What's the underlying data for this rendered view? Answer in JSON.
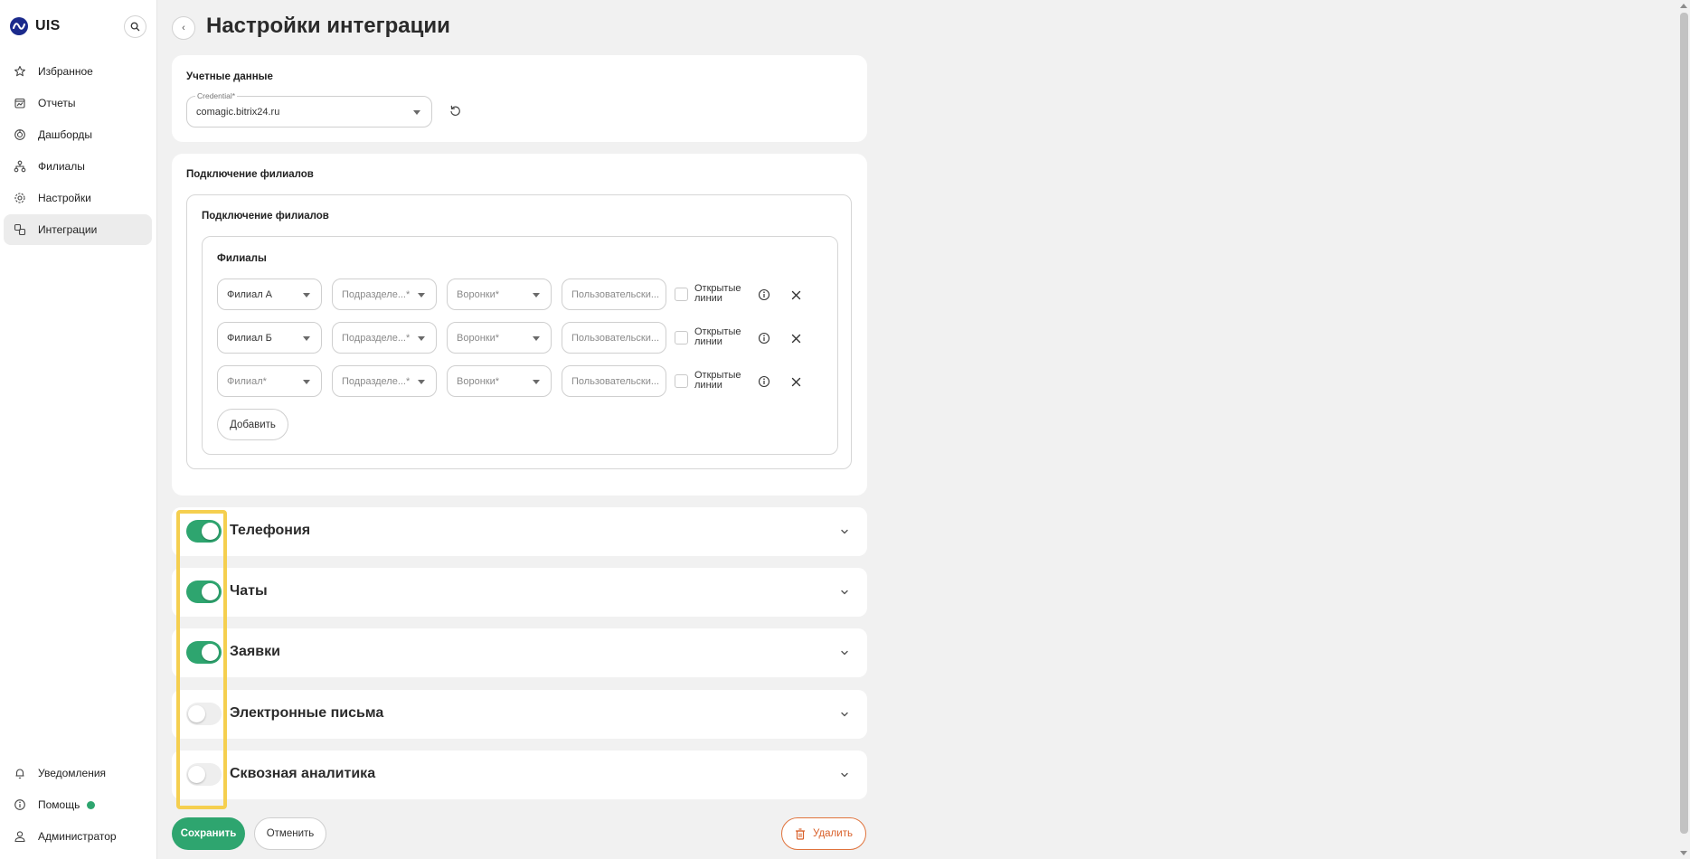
{
  "app": {
    "logo_text": "UIS"
  },
  "sidebar": {
    "items": [
      {
        "label": "Избранное",
        "icon": "star-icon"
      },
      {
        "label": "Отчеты",
        "icon": "reports-icon"
      },
      {
        "label": "Дашборды",
        "icon": "dashboard-icon"
      },
      {
        "label": "Филиалы",
        "icon": "branches-icon"
      },
      {
        "label": "Настройки",
        "icon": "gear-icon"
      },
      {
        "label": "Интеграции",
        "icon": "integrations-icon",
        "active": true
      }
    ],
    "bottom": [
      {
        "label": "Уведомления",
        "icon": "bell-icon"
      },
      {
        "label": "Помощь",
        "icon": "help-icon",
        "status_dot": true
      },
      {
        "label": "Администратор",
        "icon": "user-icon"
      }
    ]
  },
  "header": {
    "title": "Настройки интеграции"
  },
  "credentials": {
    "title": "Учетные данные",
    "field_label": "Credential*",
    "value": "comagic.bitrix24.ru"
  },
  "branches": {
    "card_title": "Подключение филиалов",
    "inner_title": "Подключение филиалов",
    "group_title": "Филиалы",
    "rows": [
      {
        "branch": "Филиал А",
        "branch_is_placeholder": false,
        "division": "Подразделе...*",
        "funnels": "Воронки*",
        "users": "Пользовательски...",
        "open_lines": "Открытые линии"
      },
      {
        "branch": "Филиал Б",
        "branch_is_placeholder": false,
        "division": "Подразделе...*",
        "funnels": "Воронки*",
        "users": "Пользовательски...",
        "open_lines": "Открытые линии"
      },
      {
        "branch": "Филиал*",
        "branch_is_placeholder": true,
        "division": "Подразделе...*",
        "funnels": "Воронки*",
        "users": "Пользовательски...",
        "open_lines": "Открытые линии"
      }
    ],
    "add_label": "Добавить"
  },
  "sections": [
    {
      "label": "Телефония",
      "enabled": true
    },
    {
      "label": "Чаты",
      "enabled": true
    },
    {
      "label": "Заявки",
      "enabled": true
    },
    {
      "label": "Электронные письма",
      "enabled": false
    },
    {
      "label": "Сквозная аналитика",
      "enabled": false
    }
  ],
  "actions": {
    "save": "Сохранить",
    "cancel": "Отменить",
    "delete": "Удалить"
  },
  "colors": {
    "accent": "#2ea56f",
    "danger": "#d9602a",
    "highlight": "#f5cf4f"
  }
}
